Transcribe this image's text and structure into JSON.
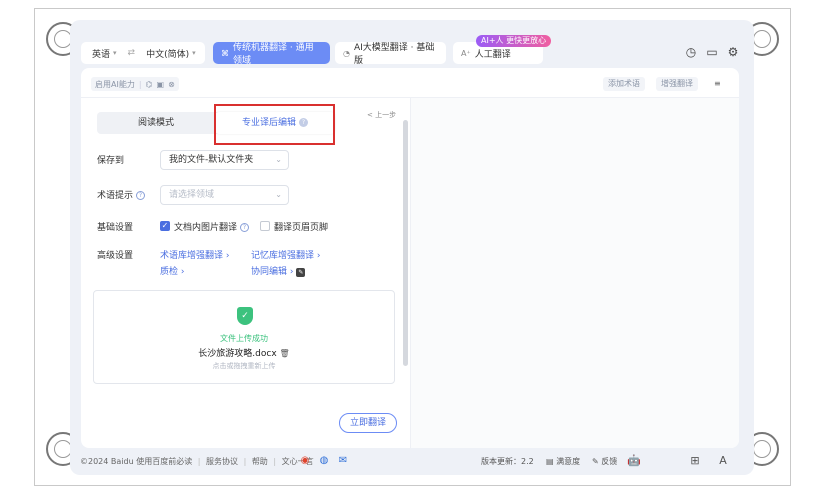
{
  "topbar": {
    "source_lang": "英语",
    "target_lang": "中文(简体)",
    "swap_glyph": "⇄",
    "tabs": [
      {
        "label": "传统机器翻译 · 通用领域",
        "icon": "machine-translate-icon"
      },
      {
        "label": "AI大模型翻译 · 基础版",
        "icon": "ai-model-icon"
      },
      {
        "label": "人工翻译",
        "icon": "human-translate-icon"
      }
    ],
    "human_badge": "AI+人 更快更放心"
  },
  "subbar": {
    "ai_toggle_label": "启用AI能力",
    "add_term": "添加术语",
    "enhance": "增强翻译"
  },
  "left": {
    "mode_read": "阅读模式",
    "mode_pro": "专业译后编辑",
    "prev_step": "< 上一步",
    "save_to_label": "保存到",
    "save_to_value": "我的文件-默认文件夹",
    "term_hint_label": "术语提示",
    "term_hint_placeholder": "请选择领域",
    "basic_label": "基础设置",
    "opt_image_translate": "文档内图片翻译",
    "opt_header_footer": "翻译页眉页脚",
    "advanced_label": "高级设置",
    "link_term_enhance": "术语库增强翻译",
    "link_memory_enhance": "记忆库增强翻译",
    "link_qa": "质检",
    "link_collab": "协同编辑",
    "upload_status": "文件上传成功",
    "upload_filename": "长沙旅游攻略.docx",
    "upload_hint": "点击或拖拽重新上传",
    "translate_button": "立即翻译"
  },
  "footer": {
    "copyright": "©2024 Baidu",
    "links": [
      "使用百度前必读",
      "服务协议",
      "帮助",
      "文心一言"
    ],
    "version_label": "版本更新：2.2",
    "satisfaction": "满意度",
    "feedback": "反馈"
  },
  "colors": {
    "accent": "#6c8cf5",
    "link": "#4a6ee0",
    "success": "#3cc27e",
    "highlight_box": "#d9302f"
  }
}
